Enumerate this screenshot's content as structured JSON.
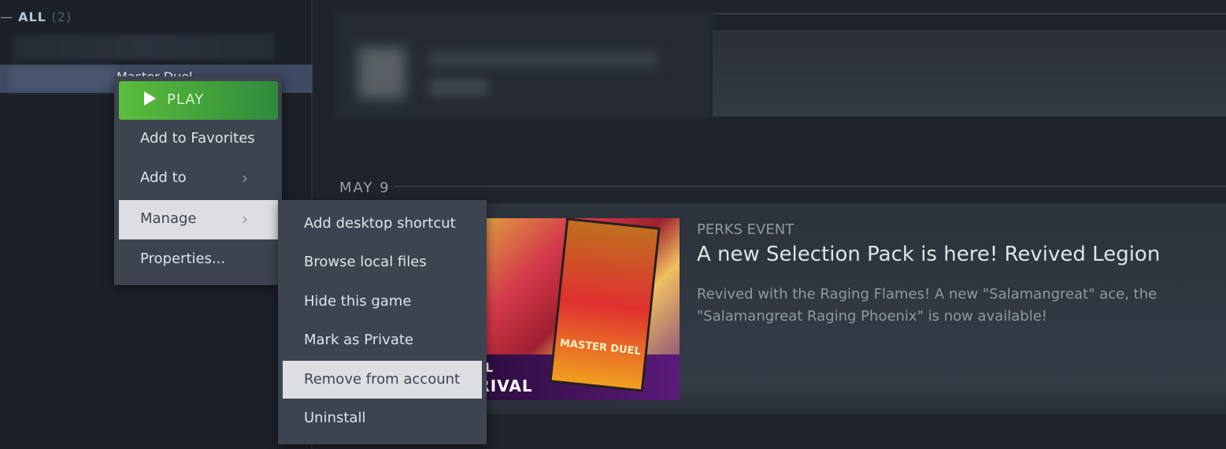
{
  "sidebar": {
    "section_label": "ALL",
    "section_count": "(2)",
    "selected_game": "Master Duel"
  },
  "feed": {
    "date": "MAY 9",
    "event": {
      "type": "PERKS EVENT",
      "title": "A new Selection Pack is here! Revived Legion",
      "description": "Revived with the Raging Flames! A new \"Salamangreat\" ace, the \"Salamangreat Raging Phoenix\" is now available!",
      "image_text": [
        "UEL",
        "RRIVAL",
        "MASTER DUEL"
      ]
    }
  },
  "context_menu": {
    "play": "PLAY",
    "items": [
      {
        "label": "Add to Favorites"
      },
      {
        "label": "Add to",
        "submenu": true
      },
      {
        "label": "Manage",
        "submenu": true,
        "highlighted": true
      },
      {
        "label": "Properties..."
      }
    ]
  },
  "manage_submenu": {
    "items": [
      {
        "label": "Add desktop shortcut"
      },
      {
        "label": "Browse local files"
      },
      {
        "label": "Hide this game"
      },
      {
        "label": "Mark as Private"
      },
      {
        "label": "Remove from account",
        "highlighted": true
      },
      {
        "label": "Uninstall"
      }
    ]
  },
  "colors": {
    "play_green": "#5bbd3c",
    "menu_bg": "#3d4450",
    "highlight": "#dcdee1",
    "selected_row": "#3e4a61"
  }
}
